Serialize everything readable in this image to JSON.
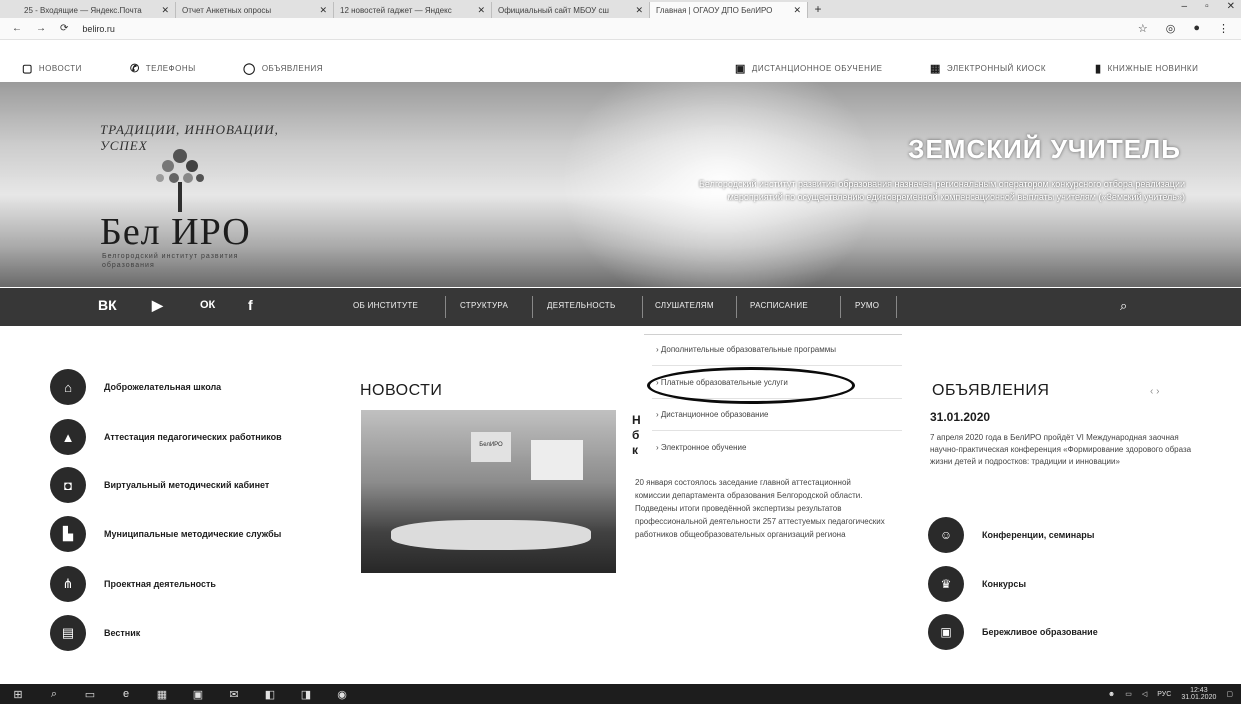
{
  "browser": {
    "tabs": [
      {
        "title": "25 - Входящие — Яндекс.Почта",
        "active": false
      },
      {
        "title": "Отчет Анкетных опросы",
        "active": false
      },
      {
        "title": "12 новостей гаджет — Яндекс",
        "active": false
      },
      {
        "title": "Официальный сайт МБОУ сш",
        "active": false
      },
      {
        "title": "Главная | ОГАОУ ДПО БелИРО",
        "active": true
      }
    ],
    "url": "beliro.ru"
  },
  "toplinks": {
    "news": "НОВОСТИ",
    "phones": "ТЕЛЕФОНЫ",
    "ads": "ОБЪЯВЛЕНИЯ",
    "distance": "ДИСТАНЦИОННОЕ ОБУЧЕНИЕ",
    "kiosk": "ЭЛЕКТРОННЫЙ КИОСК",
    "books": "КНИЖНЫЕ НОВИНКИ"
  },
  "logo": {
    "arc": "ТРАДИЦИИ, ИННОВАЦИИ, УСПЕХ",
    "name": "Бел ИРО",
    "sub": "Белгородский институт развития образования"
  },
  "hero": {
    "title": "ЗЕМСКИЙ УЧИТЕЛЬ",
    "text": "Белгородский институт развития образования назначен региональным оператором конкурсного отбора реализации мероприятий по осуществлению единовременной компенсационной выплаты учителям («Земский учитель»)"
  },
  "nav": {
    "social": [
      "ВК",
      "▶",
      "ОК",
      "f"
    ],
    "items": [
      "ОБ ИНСТИТУТЕ",
      "СТРУКТУРА",
      "ДЕЯТЕЛЬНОСТЬ",
      "СЛУШАТЕЛЯМ",
      "РАСПИСАНИЕ",
      "РУМО"
    ]
  },
  "dropdown": {
    "items": [
      "Дополнительные образовательные программы",
      "Платные образовательные услуги",
      "Дистанционное образование",
      "Электронное обучение"
    ]
  },
  "leftmenu": {
    "items": [
      "Доброжелательная школа",
      "Аттестация педагогических работников",
      "Виртуальный методический кабинет",
      "Муниципальные методические службы",
      "Проектная деятельность",
      "Вестник"
    ]
  },
  "news": {
    "heading": "НОВОСТИ",
    "fragment": [
      "Н",
      "б",
      "к"
    ],
    "text": "20 января состоялось заседание главной аттестационной комиссии департамента образования Белгородской области. Подведены итоги проведённой экспертизы результатов профессиональной деятельности 257 аттестуемых педагогических работников общеобразовательных организаций региона"
  },
  "announcements": {
    "heading": "ОБЪЯВЛЕНИЯ",
    "arrows": "‹ ›",
    "date": "31.01.2020",
    "text": "7 апреля 2020 года в БелИРО пройдёт VI Международная заочная научно-практическая конференция «Формирование здорового образа жизни детей и подростков: традиции и инновации»",
    "items": [
      "Конференции, семинары",
      "Конкурсы",
      "Бережливое образование"
    ]
  },
  "taskbar": {
    "lang": "РУС",
    "time": "12:43",
    "date": "31.01.2020"
  }
}
